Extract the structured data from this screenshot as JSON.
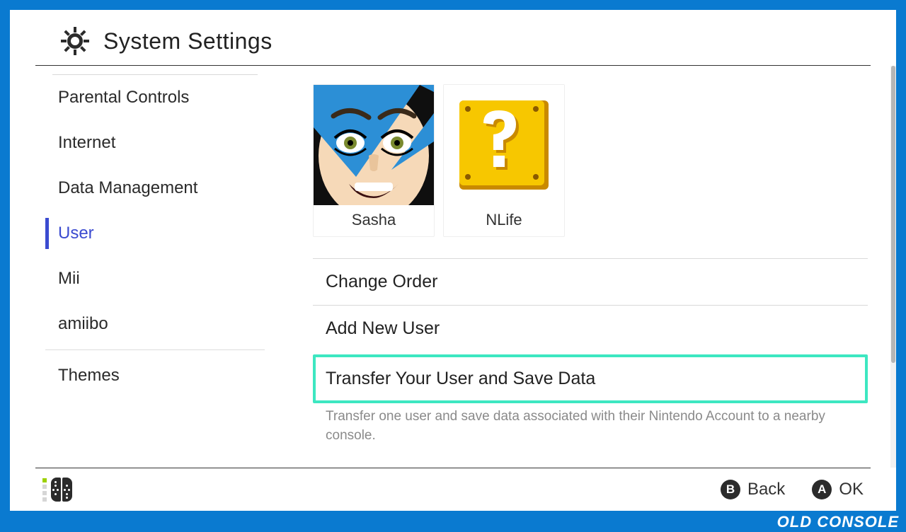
{
  "header": {
    "title": "System Settings"
  },
  "sidebar": {
    "items": [
      {
        "label": "Parental Controls",
        "selected": false
      },
      {
        "label": "Internet",
        "selected": false
      },
      {
        "label": "Data Management",
        "selected": false
      },
      {
        "label": "User",
        "selected": true
      },
      {
        "label": "Mii",
        "selected": false
      },
      {
        "label": "amiibo",
        "selected": false
      }
    ],
    "group2": [
      {
        "label": "Themes",
        "selected": false
      }
    ]
  },
  "users": [
    {
      "name": "Sasha",
      "avatar_kind": "mii"
    },
    {
      "name": "NLife",
      "avatar_kind": "question_block"
    }
  ],
  "options": {
    "change_order": "Change Order",
    "add_new_user": "Add New User",
    "transfer": "Transfer Your User and Save Data",
    "transfer_desc": "Transfer one user and save data associated with their Nintendo Account to a nearby console."
  },
  "footer": {
    "back_glyph": "B",
    "back_label": "Back",
    "ok_glyph": "A",
    "ok_label": "OK"
  },
  "caption": "OLD CONSOLE",
  "colors": {
    "accent": "#3b4bd0",
    "highlight": "#3de7c1",
    "frame": "#0a7ad0"
  }
}
